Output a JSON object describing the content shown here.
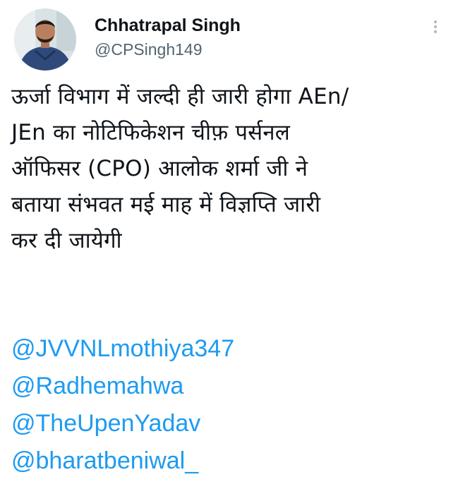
{
  "author": {
    "display_name": "Chhatrapal Singh",
    "handle": "@CPSingh149",
    "avatar_icon": "user-avatar"
  },
  "more_icon": "more-vertical-icon",
  "tweet": {
    "lines": [
      "ऊर्जा विभाग में जल्दी ही जारी होगा AEn/",
      "JEn का नोटिफिकेशन  चीफ़ पर्सनल",
      "ऑफिसर (CPO) आलोक शर्मा जी ने",
      "बताया संभवत मई माह में विज्ञप्ति जारी",
      "कर दी जायेगी"
    ],
    "mentions": [
      "@JVVNLmothiya347",
      "@Radhemahwa",
      "@TheUpenYadav",
      "@bharatbeniwal_"
    ]
  },
  "colors": {
    "mention": "#1d9bf0",
    "handle": "#536471",
    "text": "#0f1419"
  }
}
